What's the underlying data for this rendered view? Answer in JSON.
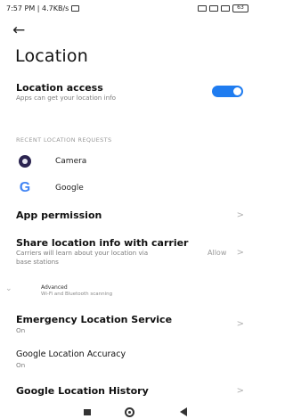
{
  "status_bar": {
    "time_speed": "7:57 PM | 4.7KB/s",
    "battery": "63"
  },
  "page": {
    "title": "Location"
  },
  "location_access": {
    "title": "Location access",
    "subtitle": "Apps can get your location info",
    "enabled": true
  },
  "recent_requests": {
    "header": "RECENT LOCATION REQUESTS",
    "apps": [
      {
        "label": "Camera",
        "icon": "camera-icon"
      },
      {
        "label": "Google",
        "icon": "google-icon"
      }
    ]
  },
  "app_permission": {
    "title": "App permission"
  },
  "share_carrier": {
    "title": "Share location info with carrier",
    "subtitle_line1": "Carriers will learn about your location via",
    "subtitle_line2": "base stations",
    "value": "Allow"
  },
  "advanced": {
    "title": "Advanced",
    "subtitle": "Wi-Fi and Bluetooth scanning"
  },
  "emergency": {
    "title": "Emergency Location Service",
    "subtitle": "On"
  },
  "accuracy": {
    "title": "Google Location Accuracy",
    "subtitle": "On"
  },
  "history": {
    "title": "Google Location History"
  },
  "colors": {
    "accent": "#1f7cf0",
    "text_primary": "#111111",
    "text_secondary": "#7d7d7d"
  }
}
